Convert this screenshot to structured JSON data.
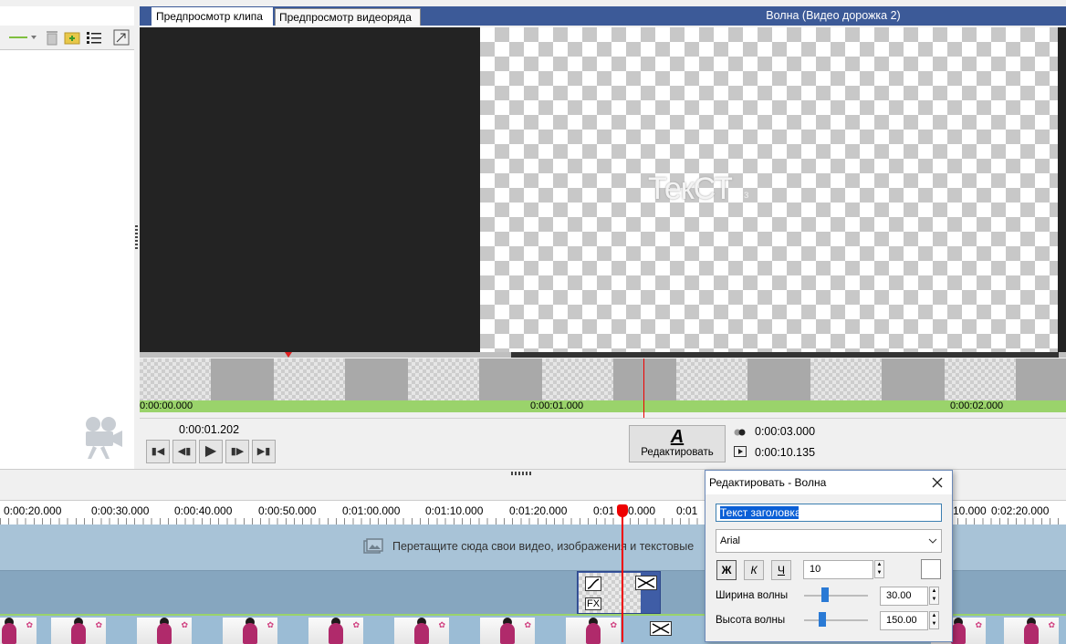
{
  "preview": {
    "tabs": [
      "Предпросмотр клипа",
      "Предпросмотр видеоряда"
    ],
    "clip_title": "Волна (Видео дорожка 2)",
    "overlay_text": "ТекСТ",
    "overlay_small": "з",
    "ruler_labels": [
      "0:00:00.000",
      "0:00:01.000",
      "0:00:02.000"
    ]
  },
  "controls": {
    "current_time": "0:00:01.202",
    "edit_label": "Редактировать",
    "edit_glyph": "A",
    "duration": "0:00:03.000",
    "total": "0:00:10.135",
    "buttons": [
      "to-start",
      "step-back",
      "play",
      "step-forward",
      "to-end"
    ]
  },
  "timeline": {
    "ruler": [
      "0:00:20.000",
      "0:00:30.000",
      "0:00:40.000",
      "0:00:50.000",
      "0:01:00.000",
      "0:01:10.000",
      "0:01:20.000",
      "0:01",
      "0.000",
      "0:01",
      "10.000",
      "0:02:20.000"
    ],
    "drop_hint": "Перетащите сюда свои видео, изображения и текстовые",
    "fx_label": "FX"
  },
  "dialog": {
    "title": "Редактировать - Волна",
    "text_value": "Текст заголовка",
    "font": "Arial",
    "bold": "Ж",
    "italic": "К",
    "underline": "Ч",
    "font_size": "10",
    "wave_width_label": "Ширина волны",
    "wave_width_value": "30.00",
    "wave_height_label": "Высота волны",
    "wave_height_value": "150.00",
    "color": "#ffffff"
  },
  "colors": {
    "tab_bar": "#3c5a98",
    "ruler_green": "#9ad36b",
    "playhead": "#ee0000"
  }
}
